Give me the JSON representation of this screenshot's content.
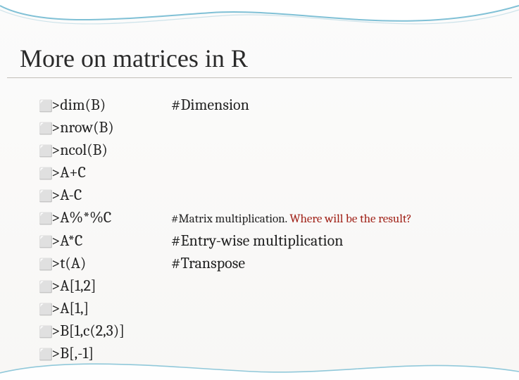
{
  "title": "More on matrices in R",
  "rows": [
    {
      "code": ">dim(B)",
      "comment_html": "<span class='dark'>#Dimension</span>"
    },
    {
      "code": ">nrow(B)",
      "comment_html": ""
    },
    {
      "code": ">ncol(B)",
      "comment_html": ""
    },
    {
      "code": ">A+C",
      "comment_html": ""
    },
    {
      "code": ">A-C",
      "comment_html": ""
    },
    {
      "code": ">A%*%C",
      "comment_html": "<span class='dark comment-small'>#Matrix multiplication. </span><span class='red comment-small'>Where will be the result?</span>"
    },
    {
      "code": ">A*C",
      "comment_html": "<span class='dark'>#Entry-wise multiplication</span>"
    },
    {
      "code": ">t(A)",
      "comment_html": "<span class='dark'>#Transpose</span>"
    },
    {
      "code": ">A[1,2]",
      "comment_html": ""
    },
    {
      "code": ">A[1,]",
      "comment_html": ""
    },
    {
      "code": ">B[1,c(2,3)]",
      "comment_html": ""
    },
    {
      "code": ">B[,-1]",
      "comment_html": ""
    }
  ],
  "bullet_glyph": "⬜"
}
